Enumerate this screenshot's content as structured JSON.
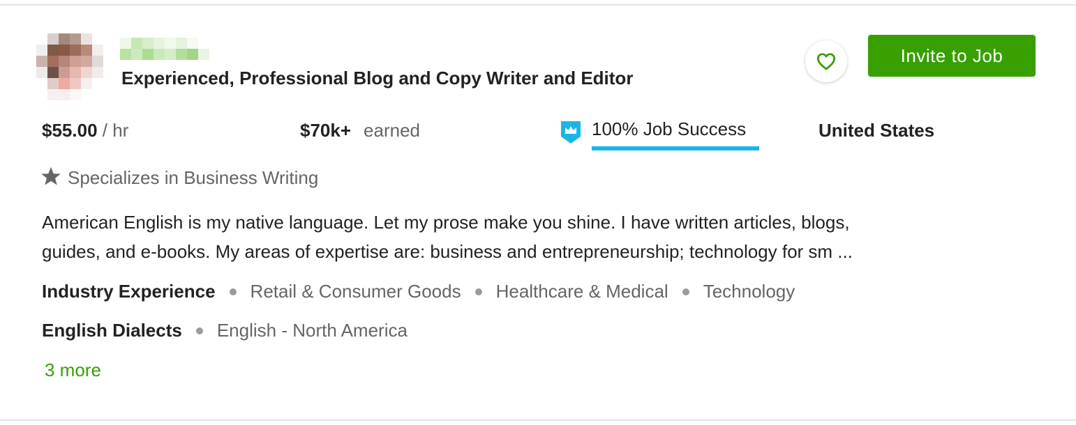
{
  "profile": {
    "title": "Experienced, Professional Blog and Copy Writer and Editor",
    "avatar_icon": "avatar-pixelated",
    "name_obscured": true
  },
  "actions": {
    "favorite_icon": "heart-outline-icon",
    "invite_label": "Invite to Job",
    "accent_color": "#37a000"
  },
  "stats": {
    "rate_amount": "$55.00",
    "rate_unit": "/ hr",
    "earned_amount": "$70k+",
    "earned_label": "earned",
    "job_success": "100% Job Success",
    "job_success_percent": 100,
    "job_success_icon": "crown-badge-icon",
    "job_success_color": "#1bb6e6",
    "country": "United States"
  },
  "specialization": {
    "icon": "star-icon",
    "text": "Specializes in Business Writing"
  },
  "description": {
    "line1": "American English is my native language. Let my prose make you shine. I have written articles, blogs,",
    "line2": "guides, and e-books. My areas of expertise are: business and entrepreneurship; technology for sm ..."
  },
  "industry_experience": {
    "heading": "Industry Experience",
    "tags": [
      "Retail & Consumer Goods",
      "Healthcare & Medical",
      "Technology"
    ]
  },
  "english_dialects": {
    "heading": "English Dialects",
    "tags": [
      "English - North America"
    ]
  },
  "more_link": "3 more"
}
